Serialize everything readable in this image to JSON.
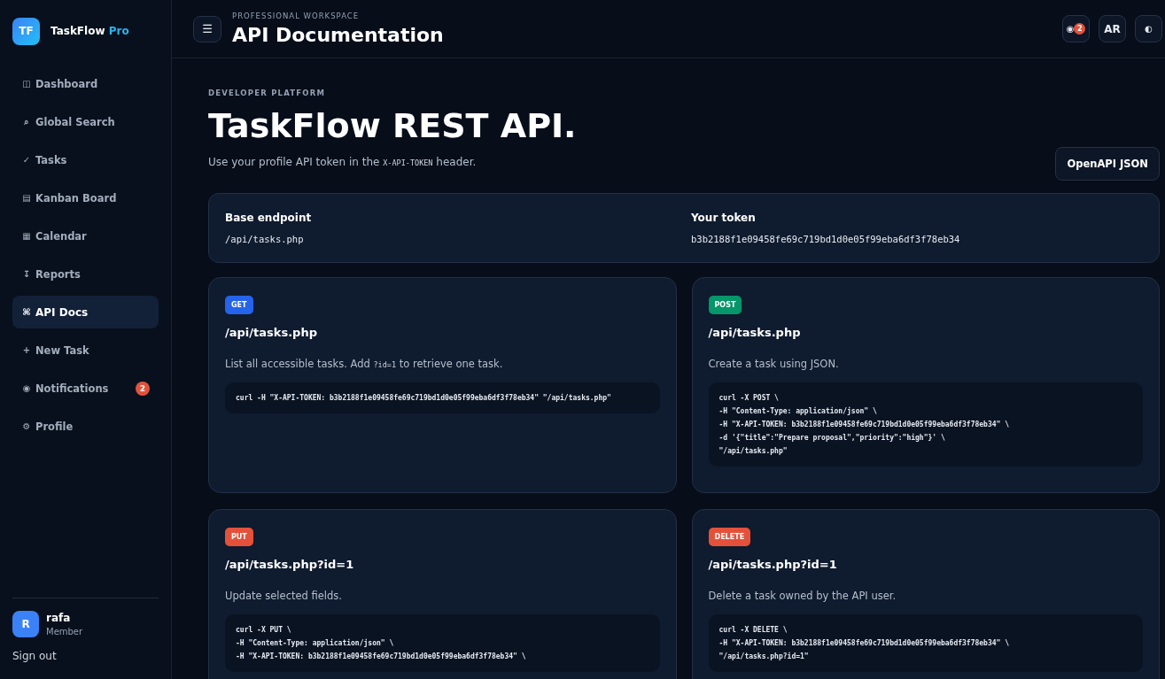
{
  "brand": {
    "logo": "TF",
    "name": "TaskFlow",
    "suffix": "Pro"
  },
  "sidebar": {
    "items": [
      {
        "icon": "◫",
        "label": "Dashboard",
        "selected": false
      },
      {
        "icon": "⌕",
        "label": "Global Search",
        "selected": false
      },
      {
        "icon": "✓",
        "label": "Tasks",
        "selected": false
      },
      {
        "icon": "▤",
        "label": "Kanban Board",
        "selected": false
      },
      {
        "icon": "▦",
        "label": "Calendar",
        "selected": false
      },
      {
        "icon": "↧",
        "label": "Reports",
        "selected": false
      },
      {
        "icon": "⌘",
        "label": "API Docs",
        "selected": true
      },
      {
        "icon": "+",
        "label": "New Task",
        "selected": false
      },
      {
        "icon": "◉",
        "label": "Notifications",
        "selected": false,
        "badge": "2"
      },
      {
        "icon": "⚙",
        "label": "Profile",
        "selected": false
      }
    ],
    "user": {
      "avatar": "R",
      "name": "rafa",
      "role": "Member"
    },
    "sign_out": "Sign out"
  },
  "topbar": {
    "eyebrow": "PROFESSIONAL WORKSPACE",
    "title": "API Documentation",
    "menu": "☰",
    "notifications": {
      "icon": "◉",
      "badge": "2"
    },
    "language": "AR",
    "theme": "◐"
  },
  "hero": {
    "eyebrow": "DEVELOPER PLATFORM",
    "title": "TaskFlow REST API.",
    "description": [
      "Use your profile API token in the ",
      "X-API-TOKEN",
      " header."
    ],
    "button": "OpenAPI JSON"
  },
  "info": [
    {
      "label": "Base endpoint",
      "value": "/api/tasks.php"
    },
    {
      "label": "Your token",
      "value": "b3b2188f1e09458fe69c719bd1d0e05f99eba6df3f78eb34"
    }
  ],
  "endpoints": [
    {
      "method": "GET",
      "color": "#2563eb",
      "path": "/api/tasks.php",
      "description": [
        "List all accessible tasks. Add ",
        "?id=1",
        " to retrieve one task."
      ],
      "code": [
        "curl -H \"X-API-TOKEN: b3b2188f1e09458fe69c719bd1d0e05f99eba6df3f78eb34\" \"/api/tasks.php\""
      ]
    },
    {
      "method": "POST",
      "color": "#059669",
      "path": "/api/tasks.php",
      "description": [
        "Create a task using JSON."
      ],
      "code": [
        "curl -X POST \\",
        "-H \"Content-Type: application/json\" \\",
        "-H \"X-API-TOKEN: b3b2188f1e09458fe69c719bd1d0e05f99eba6df3f78eb34\" \\",
        "-d '{\"title\":\"Prepare proposal\",\"priority\":\"high\"}' \\",
        "\"/api/tasks.php\""
      ]
    },
    {
      "method": "PUT",
      "color": "#e4513a",
      "path": "/api/tasks.php?id=1",
      "description": [
        "Update selected fields."
      ],
      "code": [
        "curl -X PUT \\",
        "-H \"Content-Type: application/json\" \\",
        "-H \"X-API-TOKEN: b3b2188f1e09458fe69c719bd1d0e05f99eba6df3f78eb34\" \\"
      ]
    },
    {
      "method": "DELETE",
      "color": "#e4513a",
      "path": "/api/tasks.php?id=1",
      "description": [
        "Delete a task owned by the API user."
      ],
      "code": [
        "curl -X DELETE \\",
        "-H \"X-API-TOKEN: b3b2188f1e09458fe69c719bd1d0e05f99eba6df3f78eb34\" \\",
        "\"/api/tasks.php?id=1\""
      ]
    }
  ]
}
